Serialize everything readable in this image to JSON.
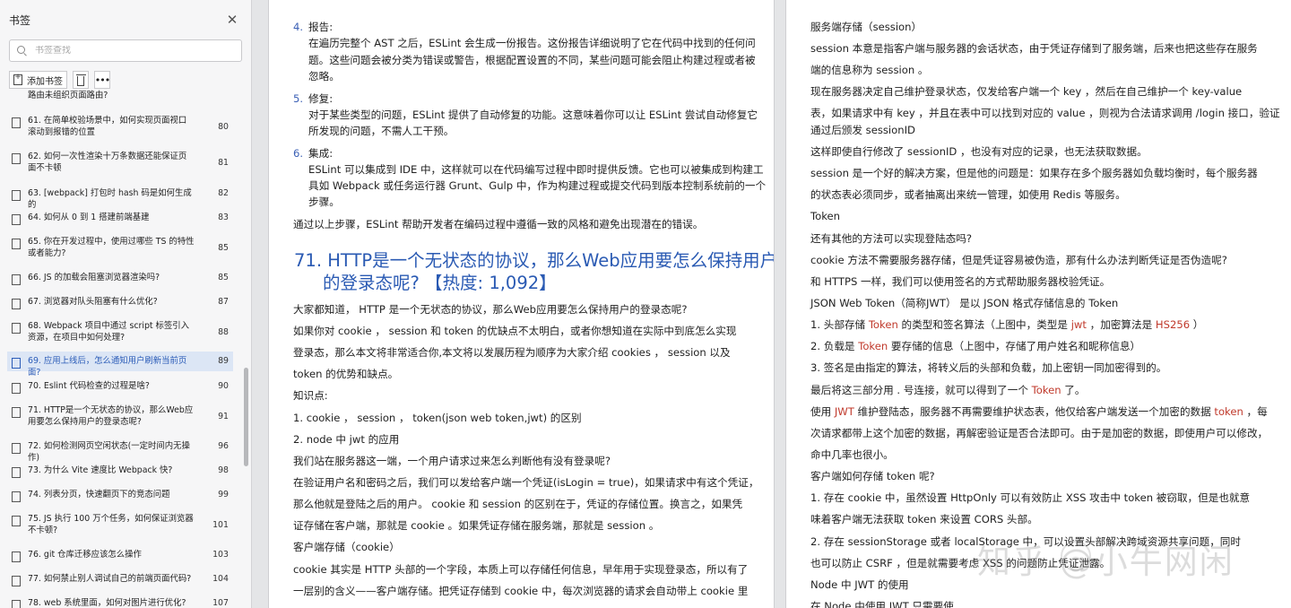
{
  "sidebar": {
    "title": "书签",
    "search_placeholder": "书签查找",
    "add_bookmark": "添加书签",
    "partial_top": "路由未组织页面路由?",
    "items": [
      {
        "label": "61. 在简单校验场景中，如何实现页面视口滚动到报错的位置",
        "page": "80"
      },
      {
        "label": "62. 如何一次性渲染十万条数据还能保证页面不卡顿",
        "page": "81"
      },
      {
        "label": "63. [webpack] 打包时 hash 码是如何生成的",
        "page": "82"
      },
      {
        "label": "64. 如何从 0 到 1 搭建前端基建",
        "page": "83"
      },
      {
        "label": "65. 你在开发过程中，使用过哪些 TS 的特性或者能力?",
        "page": "85"
      },
      {
        "label": "66. JS 的加载会阻塞浏览器渲染吗?",
        "page": "85"
      },
      {
        "label": "67. 浏览器对队头阻塞有什么优化?",
        "page": "87"
      },
      {
        "label": "68. Webpack 项目中通过 script 标签引入资源，在项目中如何处理?",
        "page": "88"
      },
      {
        "label": "69. 应用上线后，怎么通知用户刷新当前页面?",
        "page": "89"
      },
      {
        "label": "70. Eslint 代码检查的过程是啥?",
        "page": "90"
      },
      {
        "label": "71. HTTP是一个无状态的协议，那么Web应用要怎么保持用户的登录态呢?",
        "page": "91"
      },
      {
        "label": "72. 如何检测网页空闲状态(一定时间内无操作)",
        "page": "96"
      },
      {
        "label": "73. 为什么 Vite 速度比 Webpack 快?",
        "page": "98"
      },
      {
        "label": "74. 列表分页，快速翻页下的竞态问题",
        "page": "99"
      },
      {
        "label": "75. JS 执行 100 万个任务，如何保证浏览器不卡顿?",
        "page": "101"
      },
      {
        "label": "76. git 仓库迁移应该怎么操作",
        "page": "103"
      },
      {
        "label": "77. 如何禁止别人调试自己的前端页面代码?",
        "page": "104"
      },
      {
        "label": "78. web 系统里面，如何对图片进行优化?",
        "page": "107"
      }
    ]
  },
  "left_page": {
    "list_items": [
      {
        "num": "4.",
        "title": "报告:",
        "lines": [
          "在遍历完整个 AST 之后，ESLint 会生成一份报告。这份报告详细说明了它在代码中找到的任何问",
          "题。这些问题会被分类为错误或警告，根据配置设置的不同，某些问题可能会阻止构建过程或者被",
          "忽略。"
        ]
      },
      {
        "num": "5.",
        "title": "修复:",
        "lines": [
          "对于某些类型的问题，ESLint 提供了自动修复的功能。这意味着你可以让 ESLint 尝试自动修复它",
          "所发现的问题，不需人工干预。"
        ]
      },
      {
        "num": "6.",
        "title": "集成:",
        "lines": [
          "ESLint 可以集成到 IDE 中，这样就可以在代码编写过程中即时提供反馈。它也可以被集成到构建工",
          "具如 Webpack 或任务运行器 Grunt、Gulp 中，作为构建过程或提交代码到版本控制系统前的一个",
          "步骤。"
        ]
      }
    ],
    "summary": "通过以上步骤，ESLint 帮助开发者在编码过程中遵循一致的风格和避免出现潜在的错误。",
    "heading_line1": "71. HTTP是一个无状态的协议，那么Web应用要怎么保持用户",
    "heading_line2": "的登录态呢? 【热度: 1,092】",
    "body_lines": [
      "大家都知道， HTTP 是一个无状态的协议，那么Web应用要怎么保持用户的登录态呢?",
      "如果你对 cookie ， session 和 token 的优缺点不太明白，或者你想知道在实际中到底怎么实现",
      "登录态，那么本文将非常适合你,本文将以发展历程为顺序为大家介绍 cookies ， session 以及",
      "token 的优势和缺点。",
      "知识点:",
      "1. cookie ， session ， token(json web token,jwt) 的区别",
      "2. node 中 jwt 的应用",
      "我们站在服务器这一端，一个用户请求过来怎么判断他有没有登录呢?",
      "在验证用户名和密码之后，我们可以发给客户端一个凭证(isLogin = true)，如果请求中有这个凭证，",
      "那么他就是登陆之后的用户。 cookie 和 session 的区别在于，凭证的存储位置。换言之，如果凭",
      "证存储在客户端，那就是 cookie 。如果凭证存储在服务端，那就是 session 。",
      "客户端存储（cookie）",
      "cookie 其实是 HTTP 头部的一个字段，本质上可以存储任何信息，早年用于实现登录态，所以有了",
      "一层别的含义——客户端存储。把凭证存储到 cookie 中，每次浏览器的请求会自动带上 cookie 里"
    ]
  },
  "right_page": {
    "lines": [
      "服务端存储（session）",
      "session 本意是指客户端与服务器的会话状态，由于凭证存储到了服务端，后来也把这些存在服务",
      "端的信息称为 session 。",
      "现在服务器决定自己维护登录状态，仅发给客户端一个 key ，然后在自己维护一个 key-value",
      "表，如果请求中有 key ，并且在表中可以找到对应的 value ，则视为合法请求调用 /login 接口，验证",
      "通过后颁发 sessionID",
      "这样即使自行修改了 sessionID ，也没有对应的记录，也无法获取数据。",
      "session 是一个好的解决方案，但是他的问题是：如果存在多个服务器如负载均衡时，每个服务器",
      "的状态表必须同步，或者抽离出来统一管理，如使用 Redis 等服务。",
      "Token",
      "还有其他的方法可以实现登陆态吗?",
      "cookie 方法不需要服务器存储，但是凭证容易被伪造，那有什么办法判断凭证是否伪造呢?",
      "和 HTTPS 一样，我们可以使用签名的方式帮助服务器校验凭证。",
      "JSON Web Token（简称JWT） 是以 JSON 格式存储信息的 Token"
    ],
    "jwt_lines": {
      "l1a": "1. 头部存储 ",
      "l1b": "Token",
      "l1c": " 的类型和签名算法（上图中，类型是 ",
      "l1d": "jwt",
      "l1e": " ，加密算法是 ",
      "l1f": "HS256",
      "l1g": " ）",
      "l2a": "2. 负载是 ",
      "l2b": "Token",
      "l2c": " 要存储的信息（上图中，存储了用户姓名和昵称信息）",
      "l3": "3. 签名是由指定的算法，将转义后的头部和负载，加上密钥一同加密得到的。",
      "l4a": "最后将这三部分用 . 号连接，就可以得到了一个 ",
      "l4b": "Token",
      "l4c": " 了。",
      "l5a": "使用 ",
      "l5b": "JWT",
      "l5c": " 维护登陆态，服务器不再需要维护状态表，他仅给客户端发送一个加密的数据 ",
      "l5d": "token",
      "l5e": " ，每",
      "l6": "次请求都带上这个加密的数据，再解密验证是否合法即可。由于是加密的数据，即使用户可以修改，",
      "l7": "命中几率也很小。"
    },
    "tail_lines": [
      "客户端如何存储 token 呢?",
      "1. 存在 cookie 中，虽然设置 HttpOnly 可以有效防止 XSS 攻击中 token 被窃取，但是也就意",
      "味着客户端无法获取 token 来设置 CORS 头部。",
      "2. 存在 sessionStorage 或者 localStorage 中，可以设置头部解决跨域资源共享问题，同时",
      "也可以防止 CSRF ，但是就需要考虑 XSS 的问题防止凭证泄露。",
      "Node 中 JWT 的使用",
      "在 Node 中使用 JWT 只需要使"
    ]
  },
  "watermark": "知乎 @小牛网闲"
}
